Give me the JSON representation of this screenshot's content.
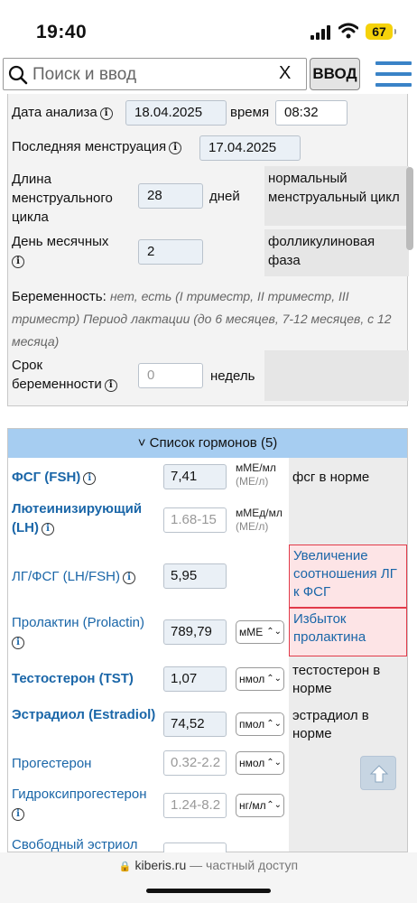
{
  "status": {
    "time": "19:40",
    "battery": "67"
  },
  "search": {
    "placeholder": "Поиск и ввод",
    "clear": "X",
    "go_label": "ВВОД"
  },
  "analysis": {
    "date_label": "Дата анализа",
    "date_value": "18.04.2025",
    "time_label": "время",
    "time_value": "08:32",
    "last_mens_label": "Последняя менструация",
    "last_mens_value": "17.04.2025",
    "cycle_label": "Длина менструального цикла",
    "cycle_value": "28",
    "cycle_unit": "дней",
    "cycle_note": "нормальный менструальный цикл",
    "day_label": "День месячных",
    "day_value": "2",
    "day_note": "фолликулиновая фаза",
    "pregnancy_label": "Беременность:",
    "pregnancy_options": "нет, есть (I триместр, II триместр, III триместр) Период лактации (до 6 месяцев, 7-12 месяцев, с 12 месяца)",
    "term_label": "Срок беременности",
    "term_placeholder": "0",
    "term_unit": "недель"
  },
  "hormones": {
    "header": "˅ Список гормонов (5)",
    "rows": [
      {
        "name": "ФСГ (FSH)",
        "value": "7,41",
        "unit": "мМЕ/мл",
        "unit2": "(МЕ/л)",
        "result": "фсг в норме"
      },
      {
        "name": "Лютеинизирующий (LH)",
        "value": "1.68-15",
        "unit": "мМЕд/мл",
        "unit2": "(МЕ/л)",
        "result": ""
      },
      {
        "name": "ЛГ/ФСГ (LH/FSH)",
        "value": "5,95",
        "unit": "",
        "unit2": "",
        "result": "Увеличение соотношения ЛГ к ФСГ"
      },
      {
        "name": "Пролактин (Prolactin)",
        "value": "789,79",
        "unit": "мМЕ",
        "unit2": "",
        "result": "Избыток пролактина"
      },
      {
        "name": "Тестостерон (TST)",
        "value": "1,07",
        "unit": "нмол",
        "unit2": "",
        "result": "тестостерон в норме"
      },
      {
        "name": "Эстрадиол (Estradiol)",
        "value": "74,52",
        "unit": "пмол",
        "unit2": "",
        "result": "эстрадиол в норме"
      },
      {
        "name": "Прогестерон",
        "value": "0.32-2.2",
        "unit": "нмол",
        "unit2": "",
        "result": ""
      },
      {
        "name": "Гидроксипрогестерон",
        "value": "1.24-8.2",
        "unit": "нг/мл",
        "unit2": "",
        "result": ""
      },
      {
        "name": "Свободный эстриол",
        "value": "",
        "unit": "",
        "unit2": "",
        "result": ""
      }
    ]
  },
  "footer": {
    "domain": "kiberis.ru",
    "access": "— частный доступ"
  },
  "colors": {
    "accent": "#3a83c7",
    "header": "#a6cdf1",
    "alert_border": "#e23b4a",
    "alert_bg": "#fde4e6",
    "link": "#1a66a8"
  }
}
